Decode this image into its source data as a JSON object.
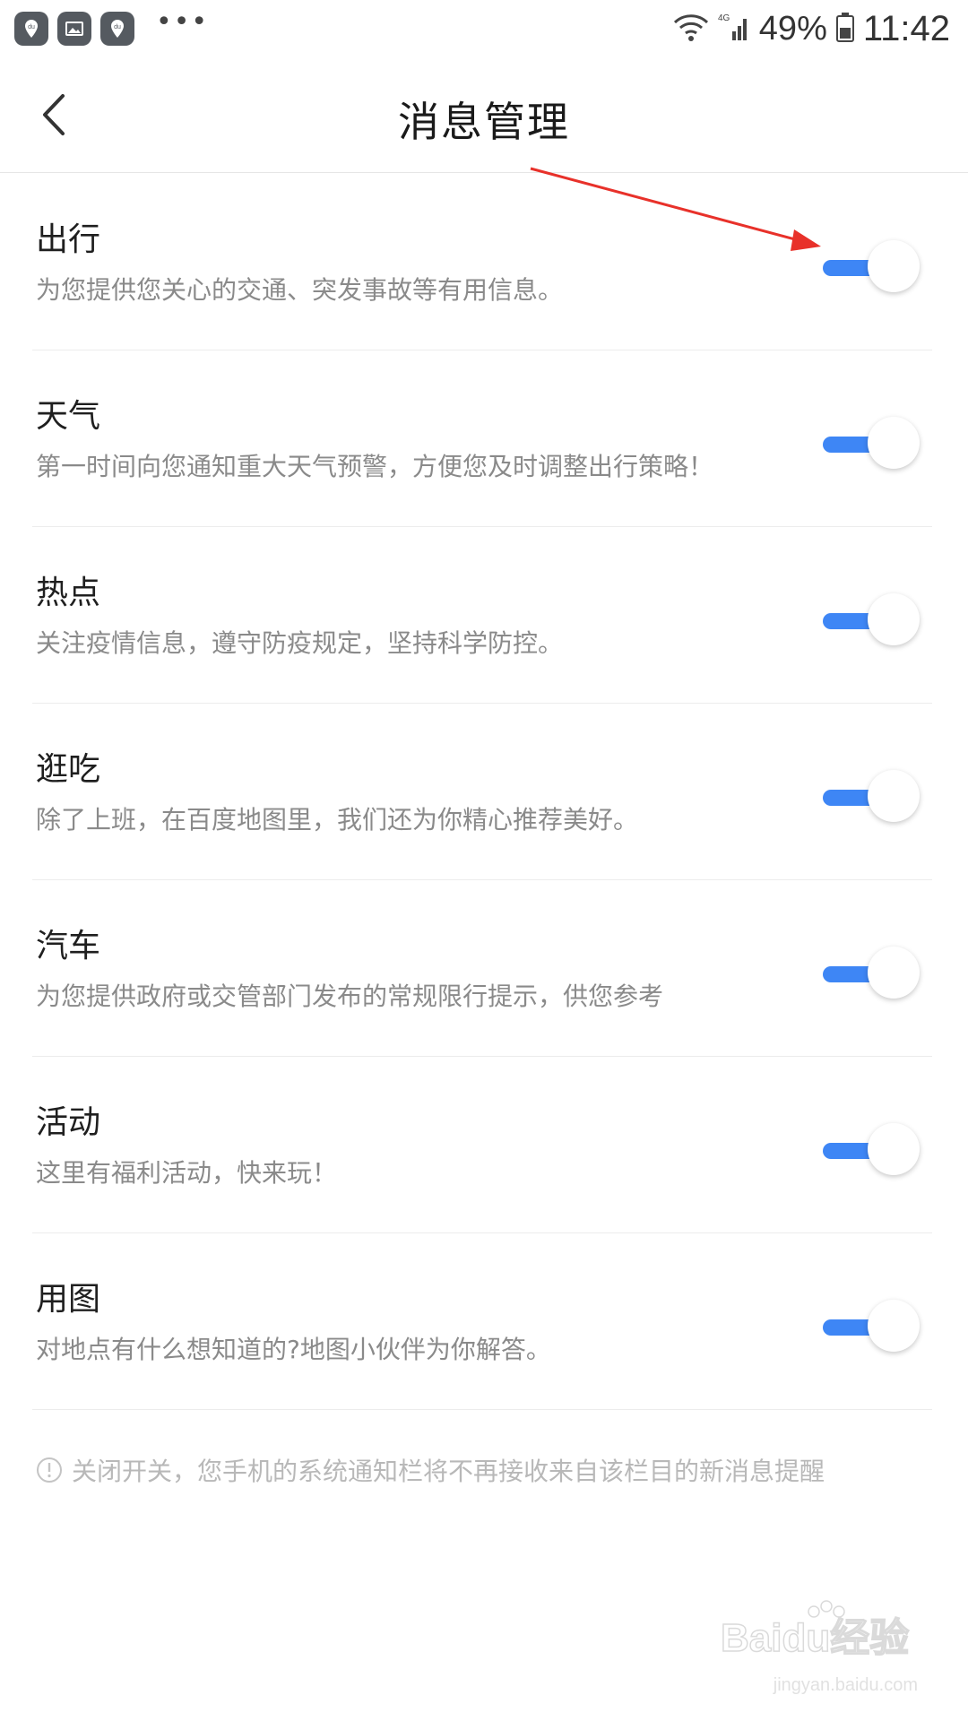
{
  "status_bar": {
    "battery": "49%",
    "time": "11:42",
    "network": "4G",
    "notification_icons": [
      "baidu-map-icon",
      "gallery-icon",
      "baidu-map-icon"
    ]
  },
  "header": {
    "title": "消息管理"
  },
  "settings": [
    {
      "title": "出行",
      "description": "为您提供您关心的交通、突发事故等有用信息。",
      "enabled": true
    },
    {
      "title": "天气",
      "description": "第一时间向您通知重大天气预警，方便您及时调整出行策略！",
      "enabled": true
    },
    {
      "title": "热点",
      "description": "关注疫情信息，遵守防疫规定，坚持科学防控。",
      "enabled": true
    },
    {
      "title": "逛吃",
      "description": "除了上班，在百度地图里，我们还为你精心推荐美好。",
      "enabled": true
    },
    {
      "title": "汽车",
      "description": "为您提供政府或交管部门发布的常规限行提示，供您参考",
      "enabled": true
    },
    {
      "title": "活动",
      "description": "这里有福利活动，快来玩！",
      "enabled": true
    },
    {
      "title": "用图",
      "description": "对地点有什么想知道的?地图小伙伴为你解答。",
      "enabled": true
    }
  ],
  "hint": {
    "text": "关闭开关，您手机的系统通知栏将不再接收来自该栏目的新消息提醒"
  },
  "watermark": {
    "brand": "Baidu经验",
    "url": "jingyan.baidu.com"
  },
  "colors": {
    "toggle_on": "#3e86f5",
    "annotation_arrow": "#e8312a"
  }
}
